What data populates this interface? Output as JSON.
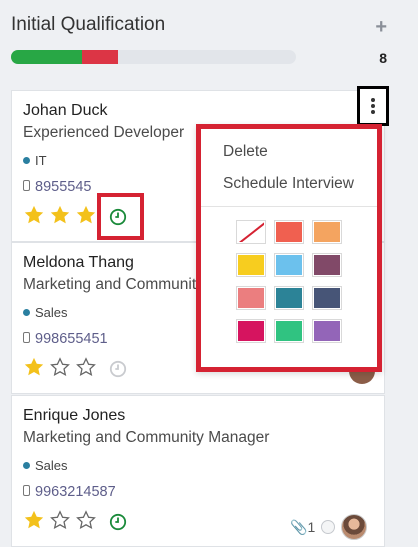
{
  "column": {
    "title": "Initial Qualification",
    "add_icon": "plus-icon",
    "count": "8",
    "progress": {
      "green_fraction": 0.25,
      "red_fraction": 0.125,
      "green_color": "#28a745",
      "red_color": "#dc3545"
    }
  },
  "cards": [
    {
      "name": "Johan Duck",
      "job": "Experienced Developer",
      "tag": "IT",
      "phone": "8955545",
      "rating": 3,
      "activity": "clock-icon-green"
    },
    {
      "name": "Meldona Thang",
      "job": "Marketing and Community Manager",
      "tag": "Sales",
      "phone": "998655451",
      "rating": 1,
      "activity": "clock-icon-grey"
    },
    {
      "name": "Enrique Jones",
      "job": "Marketing and Community Manager",
      "tag": "Sales",
      "phone": "9963214587",
      "rating": 1,
      "activity": "clock-icon-green",
      "attachments": "1"
    }
  ],
  "dropdown": {
    "items": [
      "Delete",
      "Schedule Interview"
    ],
    "colors": [
      "none",
      "#f06050",
      "#f4a460",
      "#f7cd1f",
      "#6cc1ed",
      "#814968",
      "#eb7e7f",
      "#2c8397",
      "#475577",
      "#d6145f",
      "#30c381",
      "#9365b8"
    ]
  }
}
